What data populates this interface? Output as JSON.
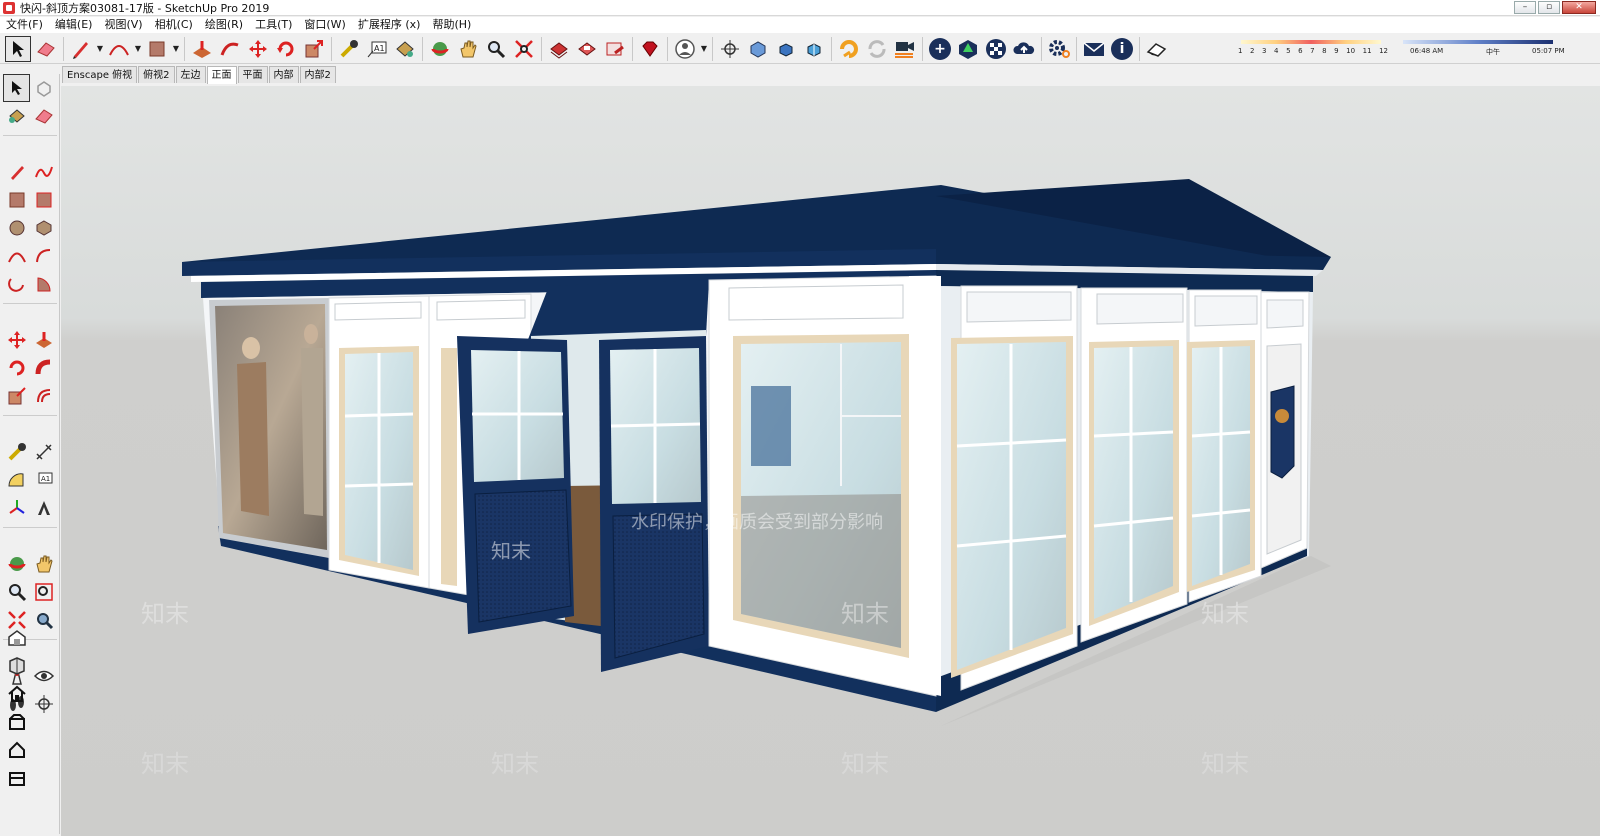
{
  "window": {
    "title": "快闪-斜顶方案03081-17版 - SketchUp Pro 2019",
    "controls": [
      "–",
      "▫",
      "✕"
    ]
  },
  "menu": [
    "文件(F)",
    "编辑(E)",
    "视图(V)",
    "相机(C)",
    "绘图(R)",
    "工具(T)",
    "窗口(W)",
    "扩展程序 (x)",
    "帮助(H)"
  ],
  "shadow": {
    "months": [
      "1",
      "2",
      "3",
      "4",
      "5",
      "6",
      "7",
      "8",
      "9",
      "10",
      "11",
      "12"
    ],
    "time_start": "06:48 AM",
    "time_noon": "中午",
    "time_end": "05:07 PM"
  },
  "scenes": [
    {
      "label": "Enscape 俯视",
      "active": false
    },
    {
      "label": "俯视2",
      "active": false
    },
    {
      "label": "左边",
      "active": false
    },
    {
      "label": "正面",
      "active": true
    },
    {
      "label": "平面",
      "active": false
    },
    {
      "label": "内部",
      "active": false
    },
    {
      "label": "内部2",
      "active": false
    }
  ],
  "watermark": {
    "notice": "水印保护，画质会受到部分影响",
    "brand": "知末"
  },
  "colors": {
    "roof": "#0e2a52",
    "frame": "#ffffff",
    "glass": "#cfe3e8",
    "trim": "#e8d7b8",
    "door": "#15315f"
  },
  "icons": {
    "toolbar": [
      "select-arrow-icon",
      "eraser-icon",
      "pencil-icon",
      "arc-icon",
      "rectangle-icon",
      "pushpull-icon",
      "followme-icon",
      "move-icon",
      "rotate-icon",
      "scale-icon",
      "tape-measure-icon",
      "text-icon",
      "paint-bucket-icon",
      "orbit-icon",
      "pan-icon",
      "zoom-icon",
      "zoom-extents-icon",
      "warehouse-icon",
      "extension-warehouse-icon",
      "layout-icon",
      "ruby-icon",
      "user-account-icon",
      "section-plane-icon",
      "enscape-icon",
      "sync-icon",
      "video-icon",
      "add-icon",
      "tree-icon",
      "checker-icon",
      "cloud-icon",
      "settings-icon",
      "mail-icon",
      "info-icon",
      "shadow-eraser-icon"
    ]
  }
}
